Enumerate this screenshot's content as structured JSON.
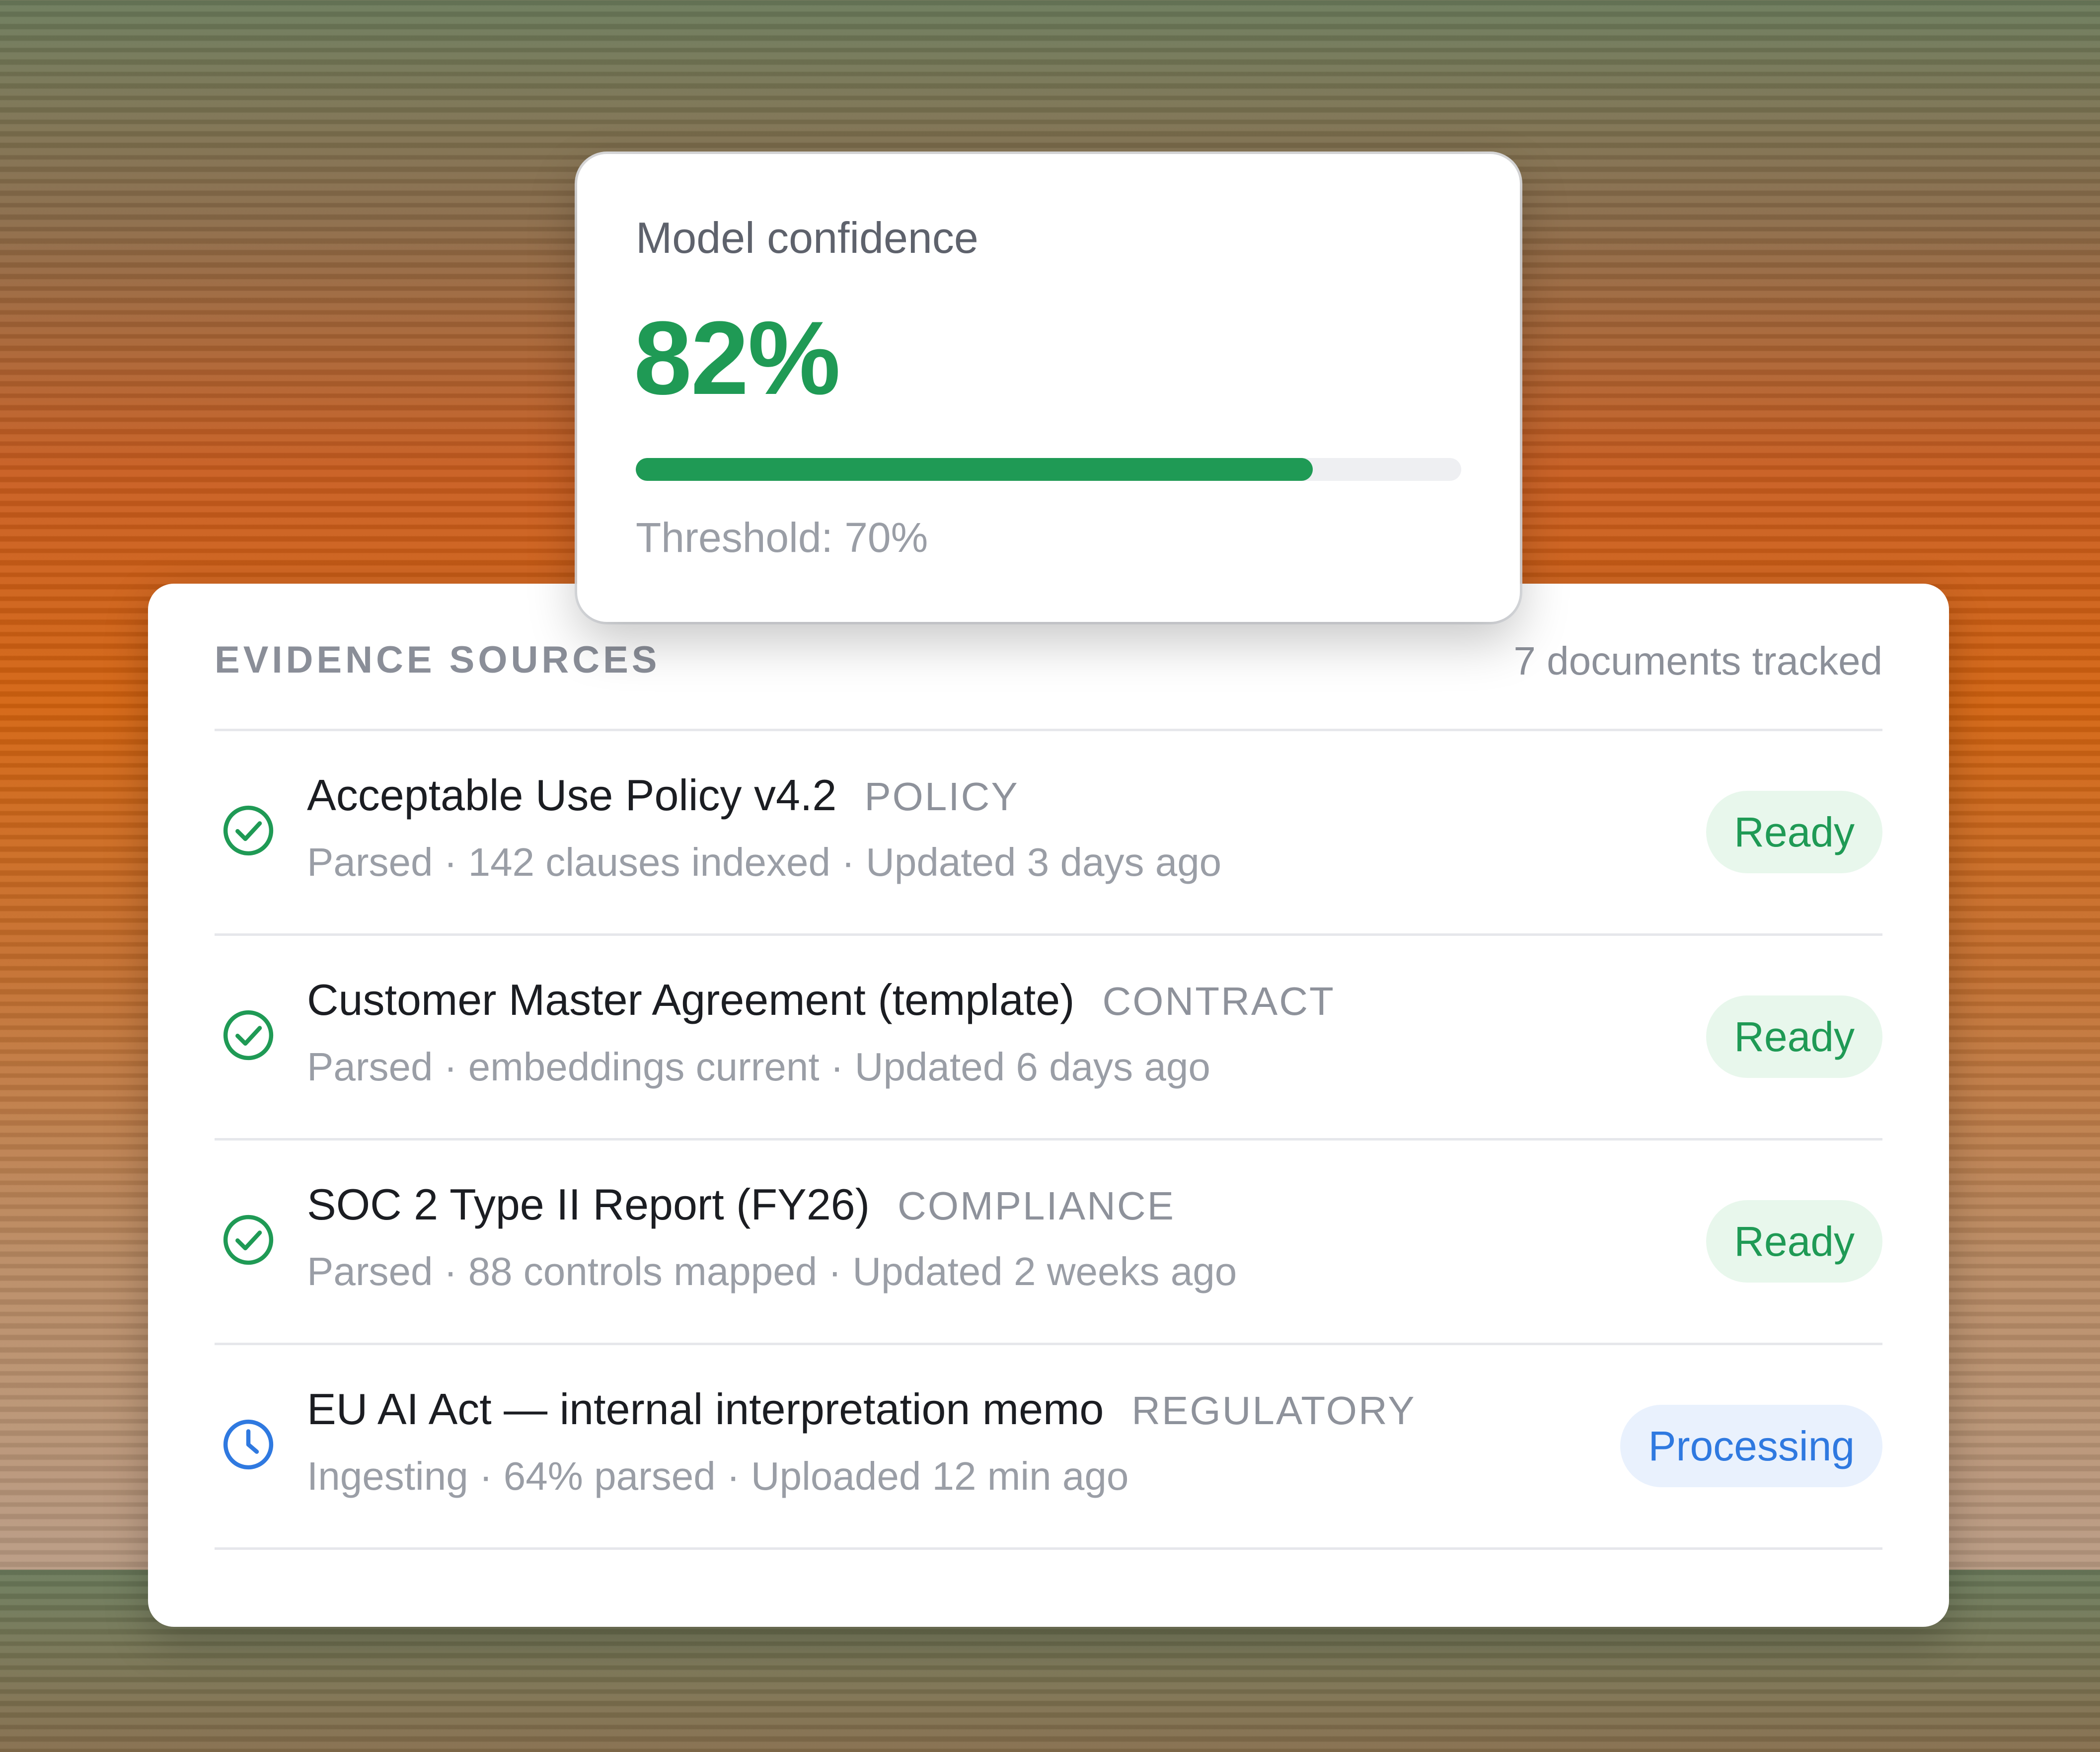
{
  "confidence_card": {
    "label": "Model confidence",
    "value": "82%",
    "progress_fraction": 0.82,
    "threshold": "Threshold: 70%",
    "accent_color": "#1f9a55"
  },
  "evidence": {
    "section_title": "EVIDENCE SOURCES",
    "tracked_count": "7 documents tracked",
    "items": [
      {
        "title": "Acceptable Use Policy v4.2",
        "category": "POLICY",
        "meta": "Parsed · 142 clauses indexed · Updated 3 days ago",
        "status": "Ready",
        "icon": "check-circle-icon"
      },
      {
        "title": "Customer Master Agreement (template)",
        "category": "CONTRACT",
        "meta": "Parsed · embeddings current · Updated 6 days ago",
        "status": "Ready",
        "icon": "check-circle-icon"
      },
      {
        "title": "SOC 2 Type II Report (FY26)",
        "category": "COMPLIANCE",
        "meta": "Parsed · 88 controls mapped · Updated 2 weeks ago",
        "status": "Ready",
        "icon": "check-circle-icon"
      },
      {
        "title": "EU AI Act — internal interpretation memo",
        "category": "REGULATORY",
        "meta": "Ingesting · 64% parsed · Uploaded 12 min ago",
        "status": "Processing",
        "icon": "clock-icon"
      }
    ]
  },
  "colors": {
    "ready": "#1f9a55",
    "processing": "#2f79e0"
  }
}
